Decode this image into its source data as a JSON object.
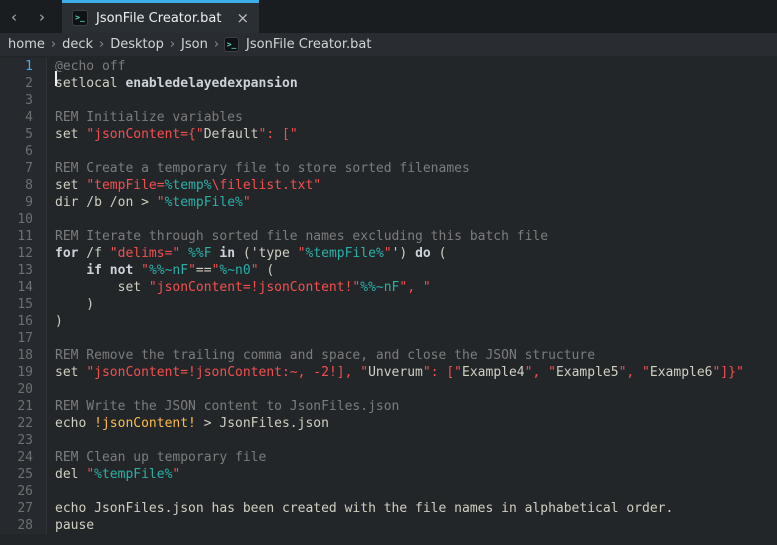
{
  "colors": {
    "accent": "#3daee9",
    "editor_bg": "#232629",
    "tabbar_bg": "#1a1d20",
    "panel_bg": "#292d31",
    "comment": "#7a7c7d",
    "normal": "#cfcfc2",
    "string": "#f44f4f",
    "variable": "#29b0a7",
    "keyword": "#ccd3db",
    "expansion": "#fdbc4b"
  },
  "tabbar": {
    "back_icon": "‹",
    "forward_icon": "›",
    "tab": {
      "icon": ">_",
      "title": "JsonFile Creator.bat",
      "close_icon": "×"
    }
  },
  "breadcrumb": {
    "separator": "›",
    "segments": [
      "home",
      "deck",
      "Desktop",
      "Json"
    ],
    "file_icon": ">_",
    "file": "JsonFile Creator.bat"
  },
  "editor": {
    "cursor": {
      "line": 1,
      "col": 1
    },
    "lines": [
      {
        "n": 1,
        "seg": [
          [
            "cm",
            "@echo off"
          ]
        ]
      },
      {
        "n": 2,
        "seg": [
          [
            "nor",
            "setlocal "
          ],
          [
            "kw",
            "enabledelayedexpansion"
          ]
        ]
      },
      {
        "n": 3,
        "seg": []
      },
      {
        "n": 4,
        "seg": [
          [
            "cm",
            "REM Initialize variables"
          ]
        ]
      },
      {
        "n": 5,
        "seg": [
          [
            "nor",
            "set "
          ],
          [
            "str",
            "\"jsonContent={\""
          ],
          [
            "nor",
            "Default"
          ],
          [
            "str",
            "\": [\""
          ]
        ]
      },
      {
        "n": 6,
        "seg": []
      },
      {
        "n": 7,
        "seg": [
          [
            "cm",
            "REM Create a temporary file to store sorted filenames"
          ]
        ]
      },
      {
        "n": 8,
        "seg": [
          [
            "nor",
            "set "
          ],
          [
            "str",
            "\"tempFile="
          ],
          [
            "var",
            "%temp%"
          ],
          [
            "str",
            "\\filelist.txt\""
          ]
        ]
      },
      {
        "n": 9,
        "seg": [
          [
            "nor",
            "dir /b /on > "
          ],
          [
            "str",
            "\""
          ],
          [
            "var",
            "%tempFile%"
          ],
          [
            "str",
            "\""
          ]
        ]
      },
      {
        "n": 10,
        "seg": []
      },
      {
        "n": 11,
        "seg": [
          [
            "cm",
            "REM Iterate through sorted file names excluding this batch file"
          ]
        ]
      },
      {
        "n": 12,
        "seg": [
          [
            "kw",
            "for"
          ],
          [
            "nor",
            " /f "
          ],
          [
            "str",
            "\"delims=\""
          ],
          [
            "nor",
            " "
          ],
          [
            "var",
            "%%F"
          ],
          [
            "nor",
            " "
          ],
          [
            "kw",
            "in"
          ],
          [
            "nor",
            " ('type "
          ],
          [
            "str",
            "\""
          ],
          [
            "var",
            "%tempFile%"
          ],
          [
            "str",
            "\""
          ],
          [
            "nor",
            "') "
          ],
          [
            "kw",
            "do"
          ],
          [
            "nor",
            " ("
          ]
        ]
      },
      {
        "n": 13,
        "seg": [
          [
            "nor",
            "    "
          ],
          [
            "kw",
            "if"
          ],
          [
            "nor",
            " "
          ],
          [
            "kw",
            "not"
          ],
          [
            "nor",
            " "
          ],
          [
            "str",
            "\""
          ],
          [
            "var",
            "%%~nF"
          ],
          [
            "str",
            "\""
          ],
          [
            "nor",
            "=="
          ],
          [
            "str",
            "\""
          ],
          [
            "var",
            "%~n0"
          ],
          [
            "str",
            "\""
          ],
          [
            "nor",
            " ("
          ]
        ]
      },
      {
        "n": 14,
        "seg": [
          [
            "nor",
            "        set "
          ],
          [
            "str",
            "\"jsonContent=!jsonContent!\""
          ],
          [
            "var",
            "%%~nF"
          ],
          [
            "str",
            "\", \""
          ]
        ]
      },
      {
        "n": 15,
        "seg": [
          [
            "nor",
            "    )"
          ]
        ]
      },
      {
        "n": 16,
        "seg": [
          [
            "nor",
            ")"
          ]
        ]
      },
      {
        "n": 17,
        "seg": []
      },
      {
        "n": 18,
        "seg": [
          [
            "cm",
            "REM Remove the trailing comma and space, and close the JSON structure"
          ]
        ]
      },
      {
        "n": 19,
        "seg": [
          [
            "nor",
            "set "
          ],
          [
            "str",
            "\"jsonContent=!jsonContent:~, -2!], \""
          ],
          [
            "nor",
            "Unverum"
          ],
          [
            "str",
            "\": [\""
          ],
          [
            "nor",
            "Example4"
          ],
          [
            "str",
            "\", \""
          ],
          [
            "nor",
            "Example5"
          ],
          [
            "str",
            "\", \""
          ],
          [
            "nor",
            "Example6"
          ],
          [
            "str",
            "\"]}\""
          ]
        ]
      },
      {
        "n": 20,
        "seg": []
      },
      {
        "n": 21,
        "seg": [
          [
            "cm",
            "REM Write the JSON content to JsonFiles.json"
          ]
        ]
      },
      {
        "n": 22,
        "seg": [
          [
            "nor",
            "echo "
          ],
          [
            "exp",
            "!jsonContent!"
          ],
          [
            "nor",
            " > JsonFiles.json"
          ]
        ]
      },
      {
        "n": 23,
        "seg": []
      },
      {
        "n": 24,
        "seg": [
          [
            "cm",
            "REM Clean up temporary file"
          ]
        ]
      },
      {
        "n": 25,
        "seg": [
          [
            "nor",
            "del "
          ],
          [
            "str",
            "\""
          ],
          [
            "var",
            "%tempFile%"
          ],
          [
            "str",
            "\""
          ]
        ]
      },
      {
        "n": 26,
        "seg": []
      },
      {
        "n": 27,
        "seg": [
          [
            "nor",
            "echo JsonFiles.json has been created with the file names in alphabetical order."
          ]
        ]
      },
      {
        "n": 28,
        "seg": [
          [
            "nor",
            "pause"
          ]
        ]
      }
    ]
  }
}
